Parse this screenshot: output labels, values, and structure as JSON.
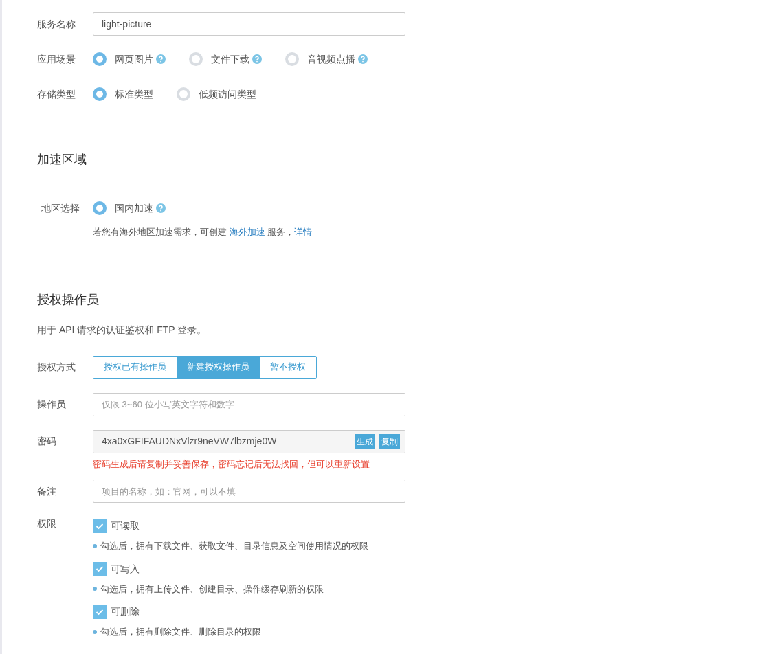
{
  "basic": {
    "service_name": {
      "label": "服务名称",
      "value": "light-picture"
    },
    "scenario": {
      "label": "应用场景",
      "options": [
        {
          "label": "网页图片",
          "selected": true,
          "help": true
        },
        {
          "label": "文件下载",
          "selected": false,
          "help": true
        },
        {
          "label": "音视频点播",
          "selected": false,
          "help": true
        }
      ]
    },
    "storage": {
      "label": "存储类型",
      "options": [
        {
          "label": "标准类型",
          "selected": true,
          "help": false
        },
        {
          "label": "低频访问类型",
          "selected": false,
          "help": false
        }
      ]
    }
  },
  "acceleration": {
    "title": "加速区域",
    "region": {
      "label": "地区选择",
      "options": [
        {
          "label": "国内加速",
          "selected": true,
          "help": true
        }
      ]
    },
    "note": [
      {
        "kind": "text",
        "text": "若您有海外地区加速需求，可创建 "
      },
      {
        "kind": "link",
        "text": "海外加速"
      },
      {
        "kind": "text",
        "text": " 服务，"
      },
      {
        "kind": "link",
        "text": "详情"
      }
    ]
  },
  "operator": {
    "title": "授权操作员",
    "description": "用于 API 请求的认证鉴权和 FTP 登录。",
    "auth_mode": {
      "label": "授权方式",
      "options": [
        {
          "label": "授权已有操作员",
          "selected": false
        },
        {
          "label": "新建授权操作员",
          "selected": true
        },
        {
          "label": "暂不授权",
          "selected": false
        }
      ]
    },
    "operator_name": {
      "label": "操作员",
      "placeholder": "仅限 3~60 位小写英文字符和数字"
    },
    "password": {
      "label": "密码",
      "value": "4xa0xGFIFAUDNxVlzr9neVW7lbzmje0W",
      "buttons": [
        "生成",
        "复制"
      ],
      "warning": "密码生成后请复制并妥善保存，密码忘记后无法找回，但可以重新设置"
    },
    "remark": {
      "label": "备注",
      "placeholder": "项目的名称，如：官网，可以不填"
    },
    "permissions": {
      "label": "权限",
      "items": [
        {
          "label": "可读取",
          "checked": true,
          "hint": "勾选后，拥有下载文件、获取文件、目录信息及空间使用情况的权限"
        },
        {
          "label": "可写入",
          "checked": true,
          "hint": "勾选后，拥有上传文件、创建目录、操作缓存刷新的权限"
        },
        {
          "label": "可删除",
          "checked": true,
          "hint": "勾选后，拥有删除文件、删除目录的权限"
        }
      ]
    }
  }
}
